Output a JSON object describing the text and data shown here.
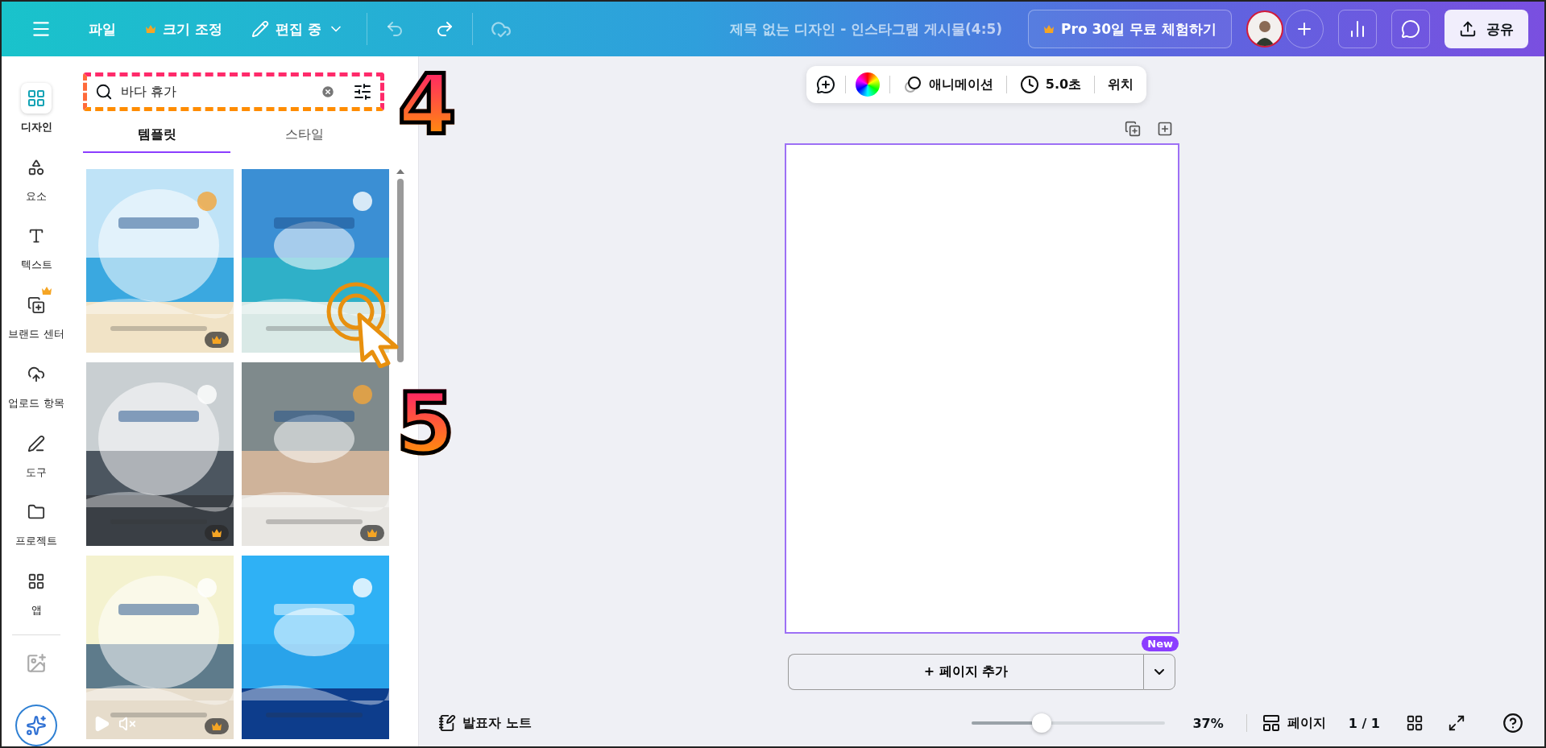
{
  "top_bar": {
    "menu_items": [
      {
        "label": "파일",
        "pro": false,
        "kind": "plain"
      },
      {
        "label": "크기 조정",
        "pro": true,
        "kind": "plain"
      },
      {
        "label": "편집 중",
        "pro": false,
        "kind": "mode"
      }
    ],
    "title": "제목 없는 디자인 - 인스타그램 게시물(4:5)",
    "pro_button": "Pro 30일 무료 체험하기",
    "share_button": "공유"
  },
  "rail": [
    {
      "label": "디자인",
      "selected": true,
      "pro": false,
      "kind": "design"
    },
    {
      "label": "요소",
      "selected": false,
      "pro": false,
      "kind": "elements"
    },
    {
      "label": "텍스트",
      "selected": false,
      "pro": false,
      "kind": "text"
    },
    {
      "label": "브랜드 센터",
      "selected": false,
      "pro": true,
      "kind": "brand"
    },
    {
      "label": "업로드 항목",
      "selected": false,
      "pro": false,
      "kind": "upload"
    },
    {
      "label": "도구",
      "selected": false,
      "pro": false,
      "kind": "tools"
    },
    {
      "label": "프로젝트",
      "selected": false,
      "pro": false,
      "kind": "projects"
    },
    {
      "label": "앱",
      "selected": false,
      "pro": false,
      "kind": "apps"
    }
  ],
  "panel": {
    "search": {
      "value": "바다 휴가"
    },
    "tabs": [
      {
        "label": "템플릿",
        "selected": true
      },
      {
        "label": "스타일",
        "selected": false
      }
    ],
    "templates": [
      {
        "kind": "picture",
        "premium": true,
        "video": false
      },
      {
        "kind": "picture",
        "premium": false,
        "video": false
      },
      {
        "kind": "picture",
        "premium": true,
        "video": false
      },
      {
        "kind": "picture",
        "premium": true,
        "video": false
      },
      {
        "kind": "picture",
        "premium": true,
        "video": true
      },
      {
        "kind": "picture",
        "premium": false,
        "video": false
      }
    ]
  },
  "toolbar": {
    "animation": "애니메이션",
    "duration": "5.0초",
    "position": "위치"
  },
  "add_page": {
    "label": "+ 페이지 추가",
    "badge": "New"
  },
  "bottom_bar": {
    "notes": "발표자 노트",
    "zoom": {
      "level": 0.36,
      "reading": "37%"
    },
    "pages": "페이지",
    "page_count": "1 / 1"
  },
  "annotations": [
    {
      "label": "4"
    },
    {
      "label": "5"
    }
  ]
}
